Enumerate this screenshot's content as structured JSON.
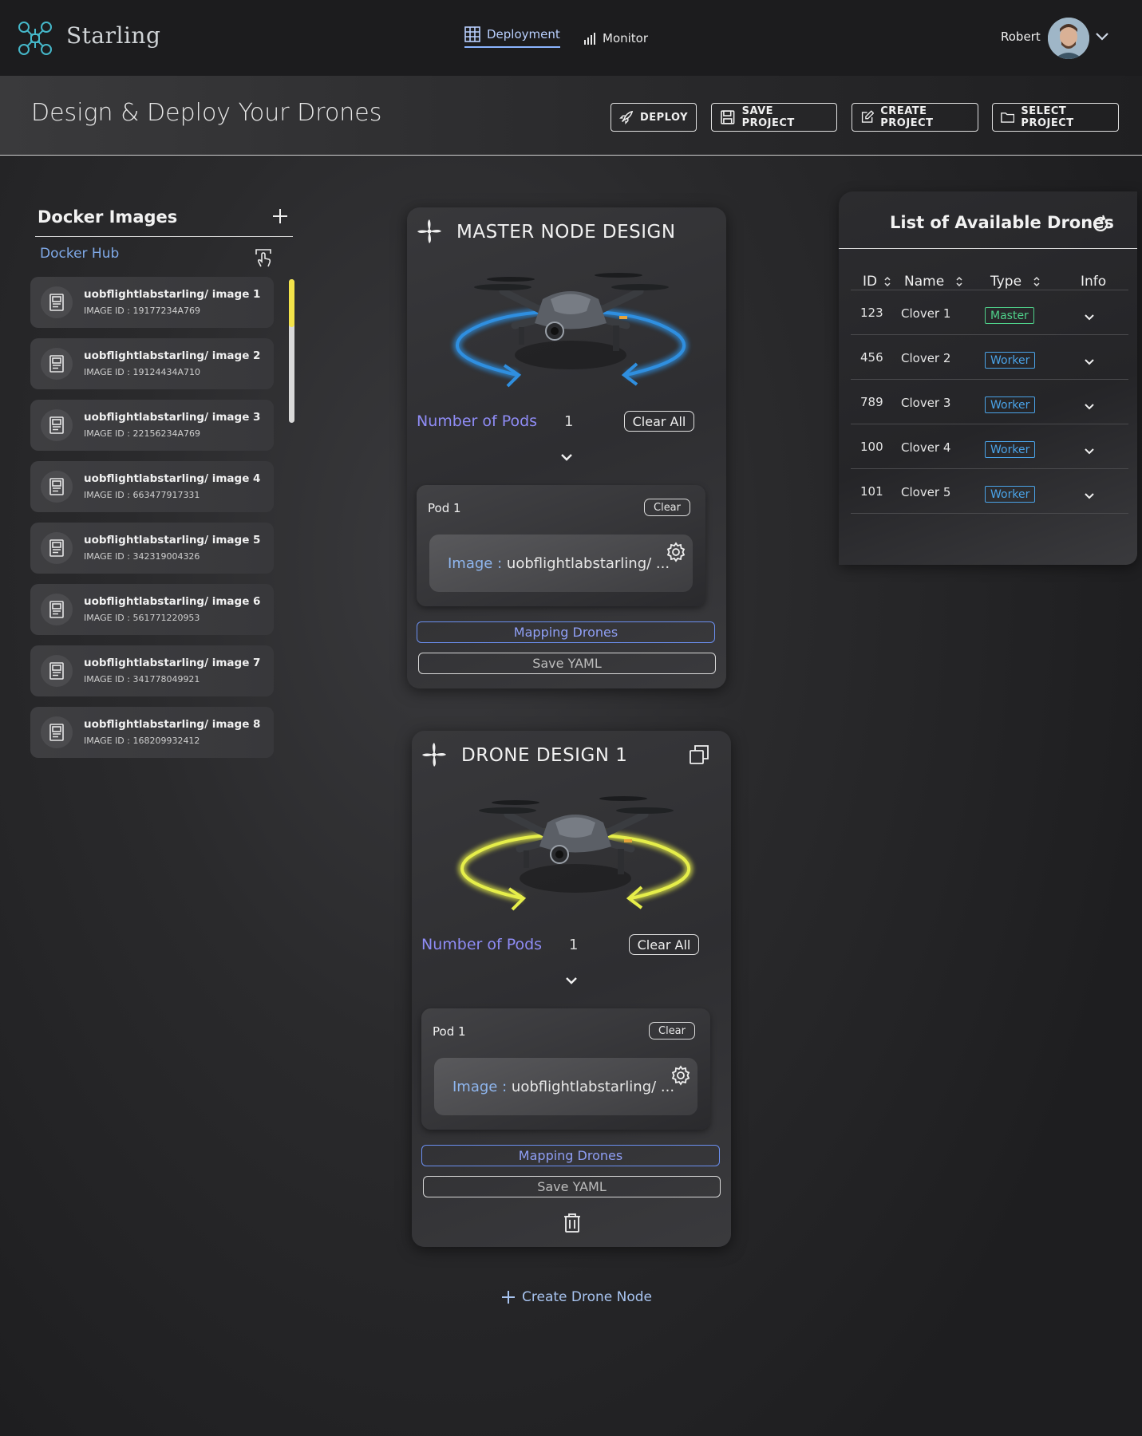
{
  "app": {
    "name": "Starling"
  },
  "nav": {
    "deployment": "Deployment",
    "monitor": "Monitor"
  },
  "user": {
    "name": "Robert"
  },
  "page": {
    "title": "Design & Deploy Your Drones"
  },
  "actions": {
    "deploy": "DEPLOY",
    "save_project": "SAVE PROJECT",
    "create_project": "CREATE PROJECT",
    "select_project": "SELECT PROJECT"
  },
  "docker": {
    "title": "Docker Images",
    "hub_label": "Docker Hub",
    "images": [
      {
        "name": "uobflightlabstarling/ image 1",
        "id": "IMAGE ID : 19177234A769"
      },
      {
        "name": "uobflightlabstarling/ image 2",
        "id": "IMAGE ID : 19124434A710"
      },
      {
        "name": "uobflightlabstarling/ image 3",
        "id": "IMAGE ID : 22156234A769"
      },
      {
        "name": "uobflightlabstarling/ image 4",
        "id": "IMAGE ID : 663477917331"
      },
      {
        "name": "uobflightlabstarling/ image 5",
        "id": "IMAGE ID : 342319004326"
      },
      {
        "name": "uobflightlabstarling/ image 6",
        "id": "IMAGE ID : 561771220953"
      },
      {
        "name": "uobflightlabstarling/ image 7",
        "id": "IMAGE ID : 341778049921"
      },
      {
        "name": "uobflightlabstarling/ image 8",
        "id": "IMAGE ID : 168209932412"
      }
    ],
    "scroll_position": 0.0
  },
  "master": {
    "title": "MASTER NODE DESIGN",
    "ring_color": "#2f8fe0",
    "pods_label": "Number of Pods",
    "pods_count": "1",
    "clear_all": "Clear All",
    "pod": {
      "title": "Pod 1",
      "clear": "Clear",
      "image_label": "Image :",
      "image_value": "uobflightlabstarling/ ..."
    },
    "mapping": "Mapping Drones",
    "save_yaml": "Save YAML"
  },
  "drone": {
    "title": "DRONE DESIGN  1",
    "ring_color": "#e6ee4a",
    "pods_label": "Number of Pods",
    "pods_count": "1",
    "clear_all": "Clear All",
    "pod": {
      "title": "Pod 1",
      "clear": "Clear",
      "image_label": "Image :",
      "image_value": "uobflightlabstarling/ ..."
    },
    "mapping": "Mapping Drones",
    "save_yaml": "Save YAML"
  },
  "create_node": "Create Drone Node",
  "drones": {
    "title": "List of Available Drones",
    "headers": {
      "id": "ID",
      "name": "Name",
      "type": "Type",
      "info": "Info"
    },
    "rows": [
      {
        "id": "123",
        "name": "Clover 1",
        "type": "Master",
        "color": "#4fd18a"
      },
      {
        "id": "456",
        "name": "Clover 2",
        "type": "Worker",
        "color": "#4aa3e8"
      },
      {
        "id": "789",
        "name": "Clover 3",
        "type": "Worker",
        "color": "#4aa3e8"
      },
      {
        "id": "100",
        "name": "Clover 4",
        "type": "Worker",
        "color": "#4aa3e8"
      },
      {
        "id": "101",
        "name": "Clover 5",
        "type": "Worker",
        "color": "#4aa3e8"
      }
    ]
  }
}
